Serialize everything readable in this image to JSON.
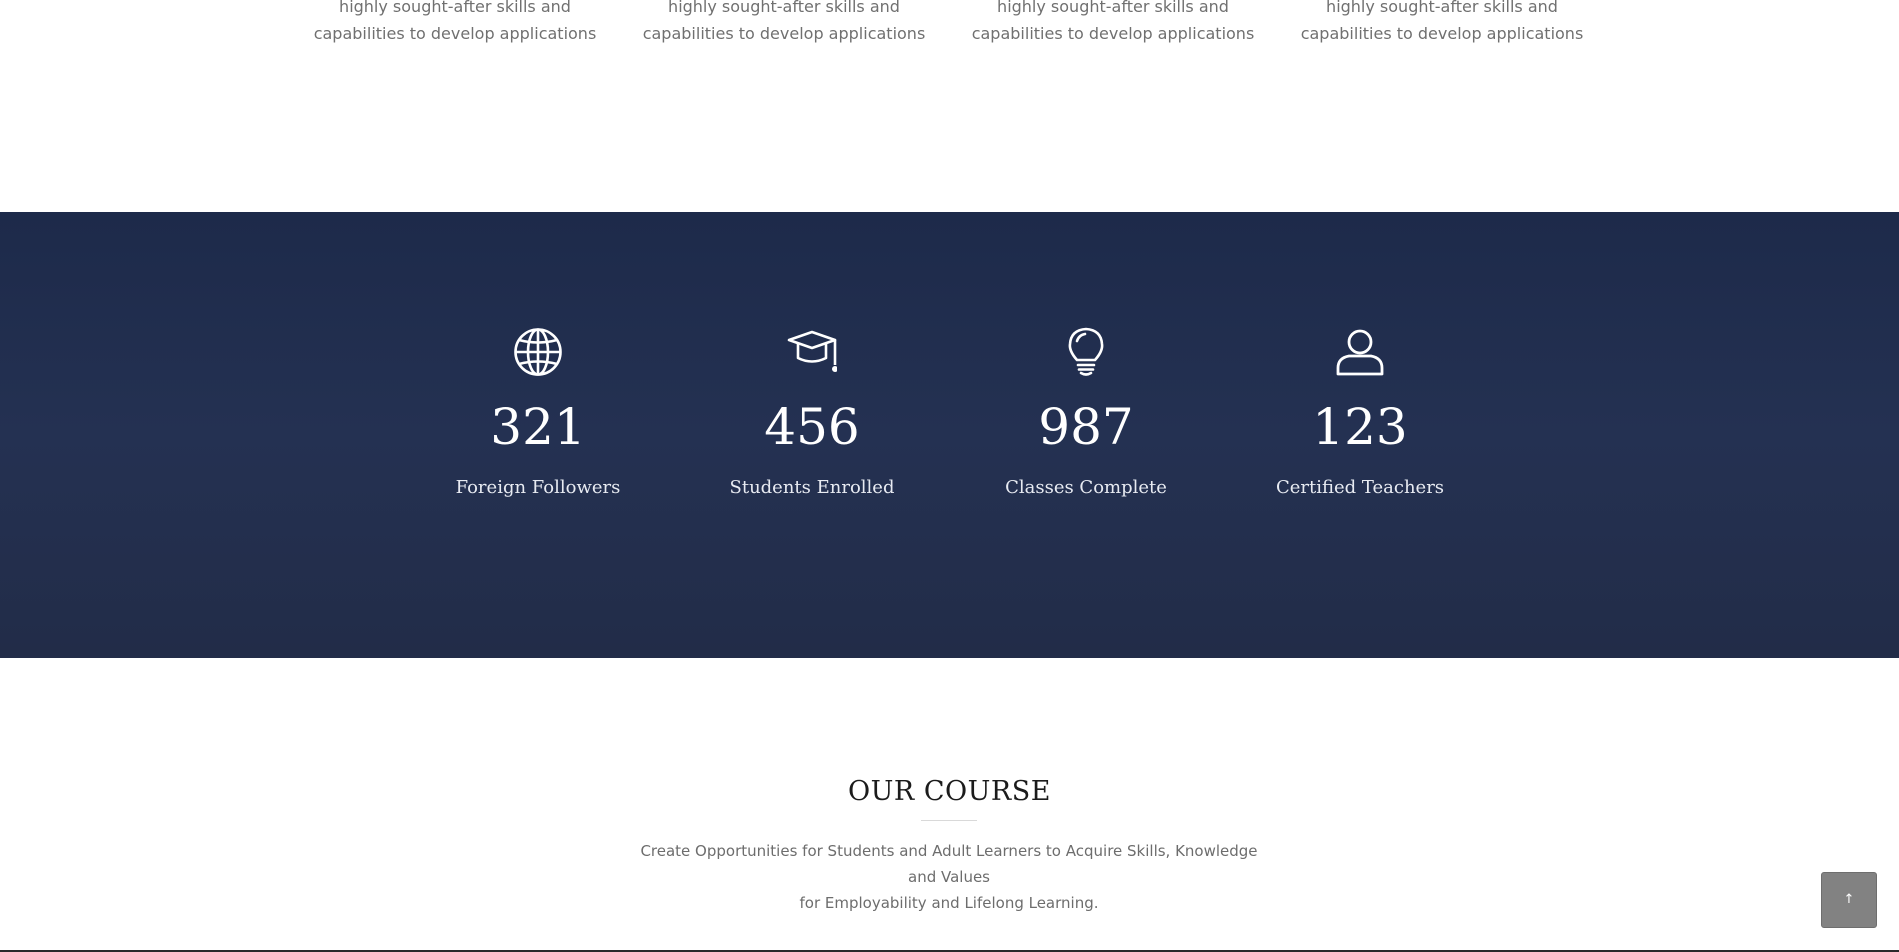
{
  "features": {
    "items": [
      {
        "line1": "highly sought-after skills and",
        "line2": "capabilities to develop applications"
      },
      {
        "line1": "highly sought-after skills and",
        "line2": "capabilities to develop applications"
      },
      {
        "line1": "highly sought-after skills and",
        "line2": "capabilities to develop applications"
      },
      {
        "line1": "highly sought-after skills and",
        "line2": "capabilities to develop applications"
      }
    ]
  },
  "stats": {
    "items": [
      {
        "icon": "globe-icon",
        "number": "321",
        "label": "Foreign Followers"
      },
      {
        "icon": "graduation-cap-icon",
        "number": "456",
        "label": "Students Enrolled"
      },
      {
        "icon": "lightbulb-icon",
        "number": "987",
        "label": "Classes Complete"
      },
      {
        "icon": "user-icon",
        "number": "123",
        "label": "Certified Teachers"
      }
    ],
    "background_color": "#1d2a4a"
  },
  "course": {
    "title": "OUR COURSE",
    "description_line1": "Create Opportunities for Students and Adult Learners to Acquire Skills, Knowledge and Values",
    "description_line2": "for Employability and Lifelong Learning."
  },
  "scroll_top": {
    "icon": "arrow-up-icon",
    "glyph": "↑",
    "color": "#828282"
  }
}
